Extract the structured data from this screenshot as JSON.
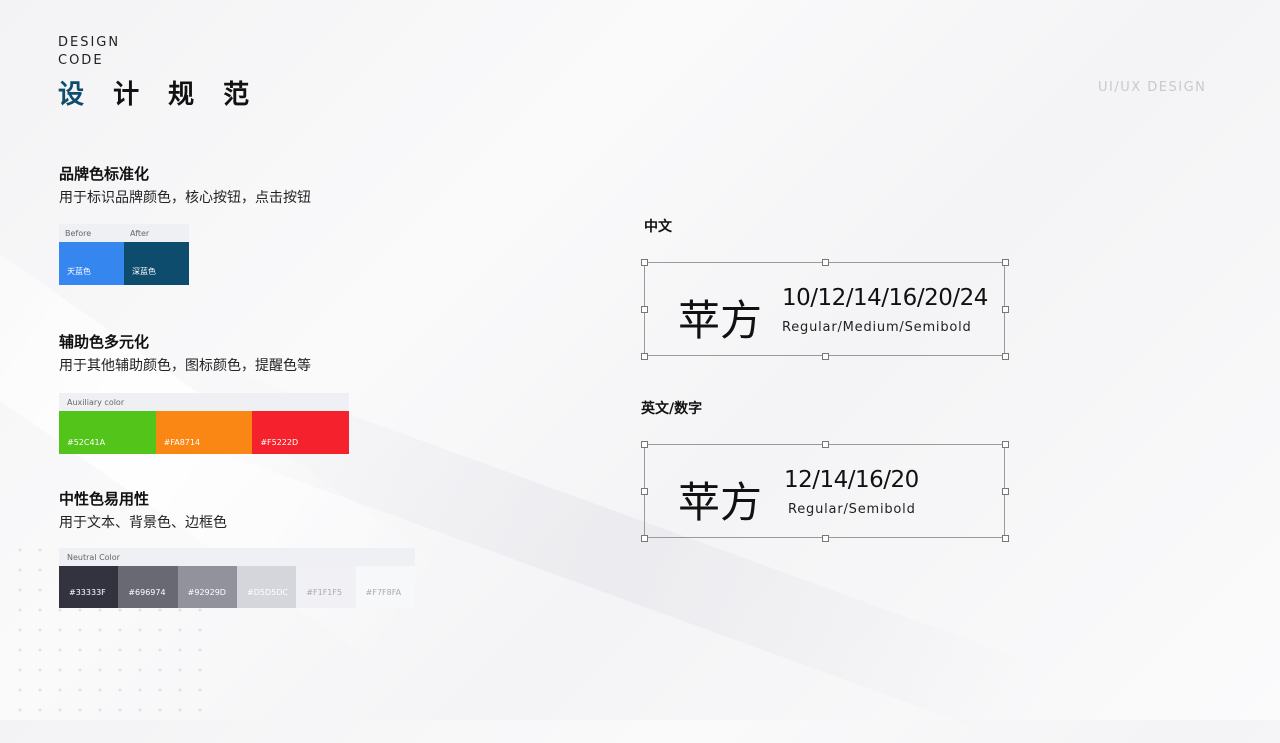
{
  "header": {
    "en_line1": "DESIGN",
    "en_line2": "CODE",
    "cn_first": "设",
    "cn_rest": "计 规 范",
    "top_right": "UI/UX DESIGN"
  },
  "brand": {
    "title": "品牌色标准化",
    "desc": "用于标识品牌颜色，核心按钮，点击按钮",
    "before_label": "Before",
    "after_label": "After",
    "swatches": [
      {
        "name": "天蓝色",
        "color": "#3686F0"
      },
      {
        "name": "深蓝色",
        "color": "#0E4C6E"
      }
    ]
  },
  "auxiliary": {
    "title": "辅助色多元化",
    "desc": "用于其他辅助颜色，图标颜色，提醒色等",
    "label": "Auxiliary color",
    "swatches": [
      {
        "code": "#52C41A",
        "color": "#52C41A"
      },
      {
        "code": "#FA8714",
        "color": "#FA8714"
      },
      {
        "code": "#F5222D",
        "color": "#F5222D"
      }
    ]
  },
  "neutral": {
    "title": "中性色易用性",
    "desc": "用于文本、背景色、边框色",
    "label": "Neutral Color",
    "swatches": [
      {
        "code": "#33333F",
        "color": "#33333F",
        "text": "#ffffff"
      },
      {
        "code": "#696974",
        "color": "#696974",
        "text": "#ffffff"
      },
      {
        "code": "#92929D",
        "color": "#92929D",
        "text": "#ffffff"
      },
      {
        "code": "#D5D5DC",
        "color": "#D5D5DC",
        "text": "#ffffff"
      },
      {
        "code": "#F1F1F5",
        "color": "#F1F1F5",
        "text": "#aaaaaa"
      },
      {
        "code": "#F7F8FA",
        "color": "#F7F8FA",
        "text": "#aaaaaa"
      }
    ]
  },
  "typography": {
    "chinese": {
      "title": "中文",
      "glyph": "苹方",
      "sizes": "10/12/14/16/20/24",
      "weights": "Regular/Medium/Semibold"
    },
    "english": {
      "title": "英文/数字",
      "glyph": "苹方",
      "sizes": "12/14/16/20",
      "weights": "Regular/Semibold"
    }
  }
}
